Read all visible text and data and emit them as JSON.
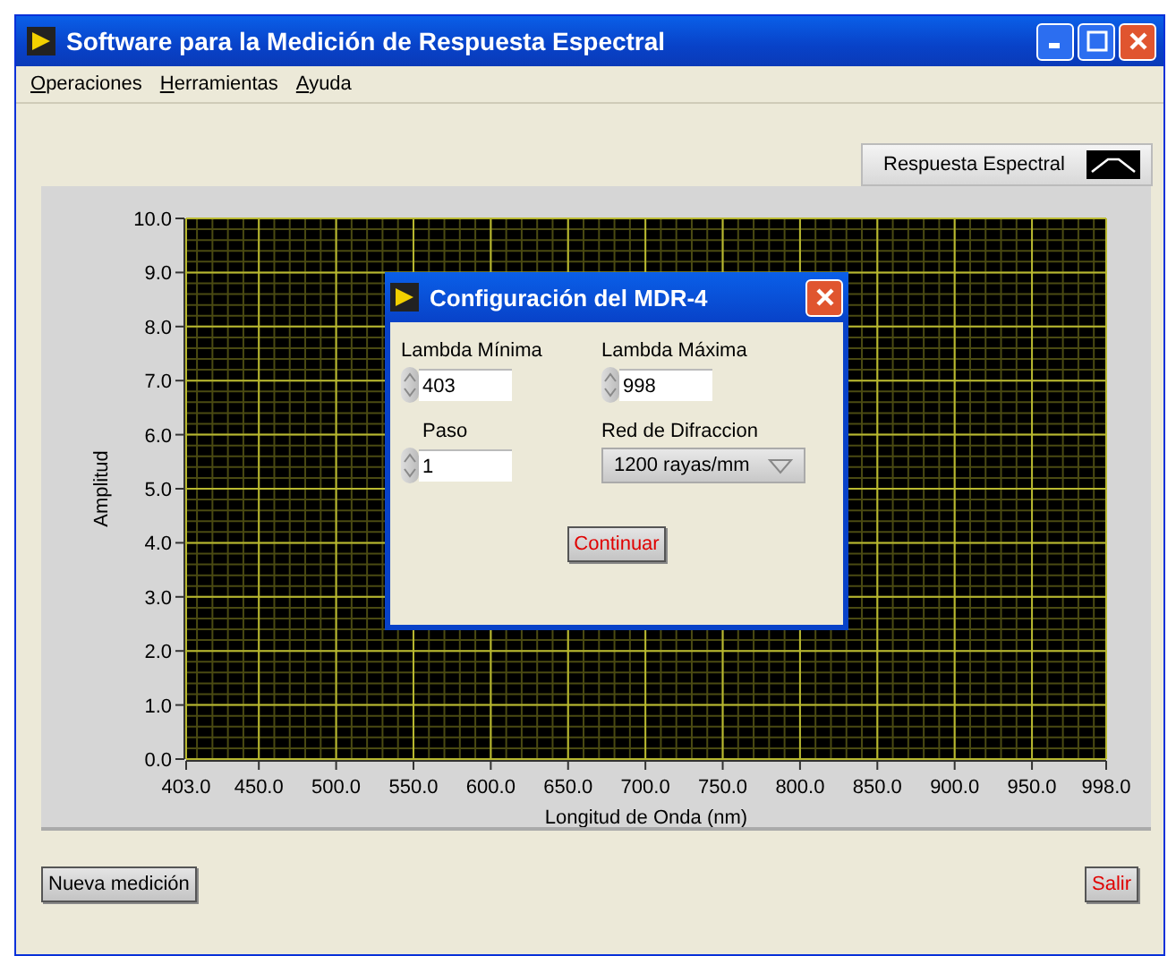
{
  "window": {
    "title": "Software para la Medición de Respuesta Espectral"
  },
  "menu": [
    {
      "label": "Operaciones"
    },
    {
      "label": "Herramientas"
    },
    {
      "label": "Ayuda"
    }
  ],
  "graph": {
    "legend": "Respuesta Espectral",
    "chart_data": {
      "type": "line",
      "grid": true,
      "xlabel": "Longitud de Onda (nm)",
      "ylabel": "Amplitud",
      "xlim": [
        403,
        998
      ],
      "ylim": [
        0,
        10
      ],
      "xticks": [
        {
          "value": 403,
          "label": "403.0"
        },
        {
          "value": 450,
          "label": "450.0"
        },
        {
          "value": 500,
          "label": "500.0"
        },
        {
          "value": 550,
          "label": "550.0"
        },
        {
          "value": 600,
          "label": "600.0"
        },
        {
          "value": 650,
          "label": "650.0"
        },
        {
          "value": 700,
          "label": "700.0"
        },
        {
          "value": 750,
          "label": "750.0"
        },
        {
          "value": 800,
          "label": "800.0"
        },
        {
          "value": 850,
          "label": "850.0"
        },
        {
          "value": 900,
          "label": "900.0"
        },
        {
          "value": 950,
          "label": "950.0"
        },
        {
          "value": 998,
          "label": "998.0"
        }
      ],
      "yticks": [
        {
          "value": 0,
          "label": "0.0"
        },
        {
          "value": 1,
          "label": "1.0"
        },
        {
          "value": 2,
          "label": "2.0"
        },
        {
          "value": 3,
          "label": "3.0"
        },
        {
          "value": 4,
          "label": "4.0"
        },
        {
          "value": 5,
          "label": "5.0"
        },
        {
          "value": 6,
          "label": "6.0"
        },
        {
          "value": 7,
          "label": "7.0"
        },
        {
          "value": 8,
          "label": "8.0"
        },
        {
          "value": 9,
          "label": "9.0"
        },
        {
          "value": 10,
          "label": "10.0"
        }
      ]
    }
  },
  "dialog": {
    "title": "Configuración del MDR-4",
    "fields": [
      {
        "label": "Lambda Mínima",
        "value": "403"
      },
      {
        "label": "Lambda Máxima",
        "value": "998"
      },
      {
        "label": "Paso",
        "value": "1"
      }
    ],
    "dropdown": {
      "label": "Red de Difraccion",
      "value": "1200 rayas/mm"
    },
    "button": "Continuar"
  },
  "buttons": [
    "Nueva medición",
    "Salir"
  ]
}
